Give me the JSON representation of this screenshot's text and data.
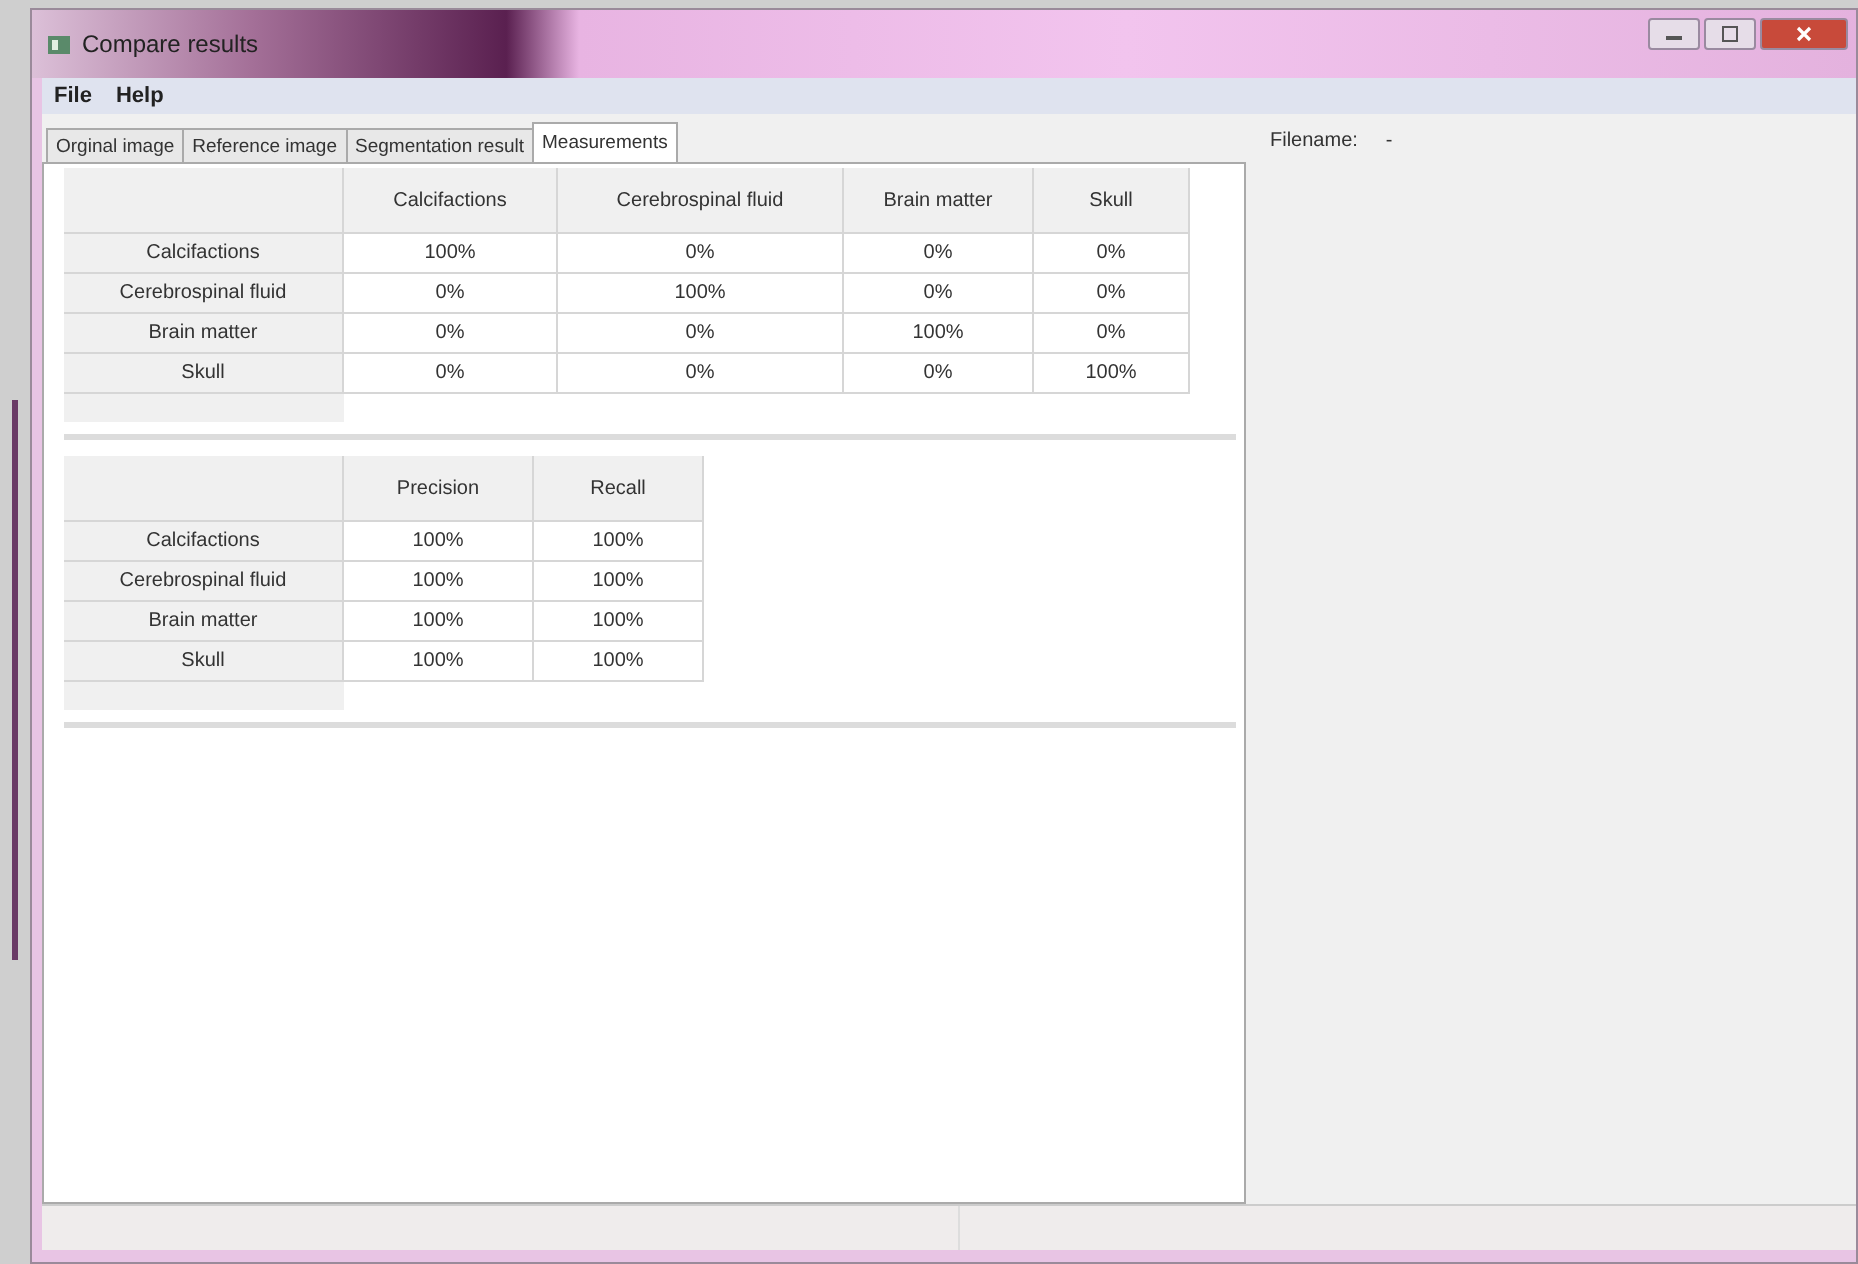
{
  "window": {
    "title": "Compare results"
  },
  "menu": [
    "File",
    "Help"
  ],
  "tabs": [
    {
      "label": "Orginal image",
      "selected": false
    },
    {
      "label": "Reference image",
      "selected": false
    },
    {
      "label": "Segmentation result",
      "selected": false
    },
    {
      "label": "Measurements",
      "selected": true
    }
  ],
  "tables": [
    {
      "columns": [
        "Calcifactions",
        "Cerebrospinal fluid",
        "Brain matter",
        "Skull"
      ],
      "rows": [
        {
          "label": "Calcifactions",
          "cells": [
            "100%",
            "0%",
            "0%",
            "0%"
          ]
        },
        {
          "label": "Cerebrospinal fluid",
          "cells": [
            "0%",
            "100%",
            "0%",
            "0%"
          ]
        },
        {
          "label": "Brain matter",
          "cells": [
            "0%",
            "0%",
            "100%",
            "0%"
          ]
        },
        {
          "label": "Skull",
          "cells": [
            "0%",
            "0%",
            "0%",
            "100%"
          ]
        }
      ]
    },
    {
      "columns": [
        "Precision",
        "Recall"
      ],
      "rows": [
        {
          "label": "Calcifactions",
          "cells": [
            "100%",
            "100%"
          ]
        },
        {
          "label": "Cerebrospinal fluid",
          "cells": [
            "100%",
            "100%"
          ]
        },
        {
          "label": "Brain matter",
          "cells": [
            "100%",
            "100%"
          ]
        },
        {
          "label": "Skull",
          "cells": [
            "100%",
            "100%"
          ]
        }
      ]
    }
  ],
  "side_panel": {
    "label": "Filename:",
    "value": "-"
  }
}
